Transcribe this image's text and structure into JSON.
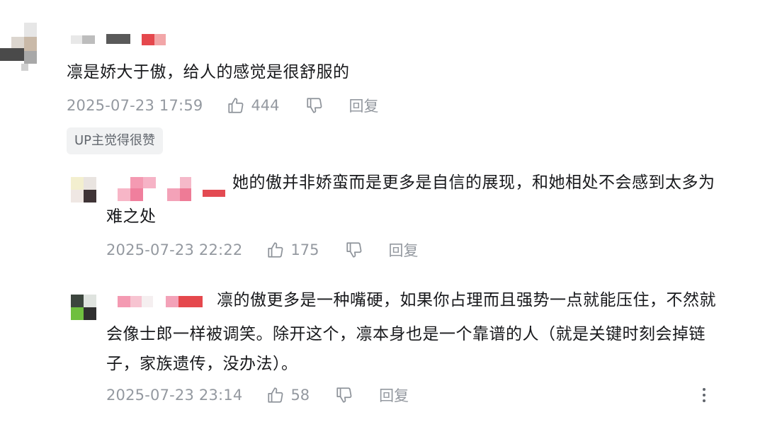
{
  "comments": [
    {
      "text": "凛是娇大于傲，给人的感觉是很舒服的",
      "time": "2025-07-23 17:59",
      "likes": "444",
      "reply_label": "回复",
      "badge": "UP主觉得很赞"
    },
    {
      "text_line1": "她的傲并非娇蛮而是更多是自信的展现，和她相处不会感到太多为",
      "text_line2": "难之处",
      "time": "2025-07-23 22:22",
      "likes": "175",
      "reply_label": "回复"
    },
    {
      "text_line1": "凛的傲更多是一种嘴硬，如果你占理而且强势一点就能压住，不然就",
      "text_line2": "会像士郎一样被调笑。除开这个，凛本身也是一个靠谱的人（就是关键时刻会掉链",
      "text_line3": "子，家族遗传，没办法）。",
      "time": "2025-07-23 23:14",
      "likes": "58",
      "reply_label": "回复"
    }
  ],
  "icons": {
    "like": "thumbs-up-icon",
    "dislike": "thumbs-down-icon",
    "more": "more-vertical-icon"
  },
  "colors": {
    "text": "#18191c",
    "meta": "#9499a0",
    "badge_bg": "#f1f2f3"
  }
}
